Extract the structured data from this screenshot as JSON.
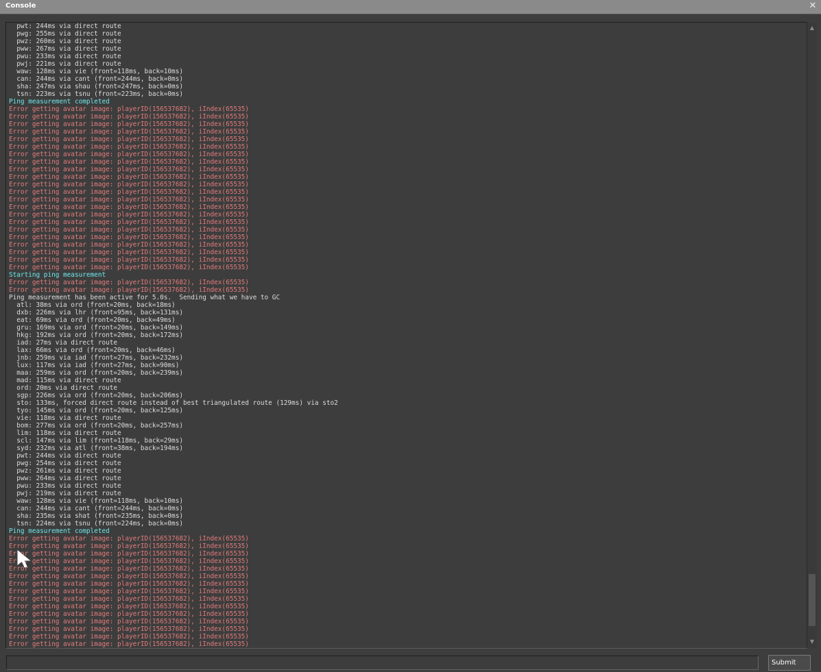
{
  "window": {
    "title": "Console",
    "close_glyph": "✕"
  },
  "console": {
    "lines": [
      {
        "text": "  pwt: 244ms via direct route",
        "type": "normal"
      },
      {
        "text": "  pwg: 255ms via direct route",
        "type": "normal"
      },
      {
        "text": "  pwz: 260ms via direct route",
        "type": "normal"
      },
      {
        "text": "  pww: 267ms via direct route",
        "type": "normal"
      },
      {
        "text": "  pwu: 233ms via direct route",
        "type": "normal"
      },
      {
        "text": "  pwj: 221ms via direct route",
        "type": "normal"
      },
      {
        "text": "  waw: 128ms via vie (front=118ms, back=10ms)",
        "type": "normal"
      },
      {
        "text": "  can: 244ms via cant (front=244ms, back=0ms)",
        "type": "normal"
      },
      {
        "text": "  sha: 247ms via shau (front=247ms, back=0ms)",
        "type": "normal"
      },
      {
        "text": "  tsn: 223ms via tsnu (front=223ms, back=0ms)",
        "type": "normal"
      },
      {
        "text": "Ping measurement completed",
        "type": "info"
      },
      {
        "text": "Error getting avatar image: playerID(156537682), iIndex(65535)",
        "type": "error"
      },
      {
        "text": "Error getting avatar image: playerID(156537682), iIndex(65535)",
        "type": "error"
      },
      {
        "text": "Error getting avatar image: playerID(156537682), iIndex(65535)",
        "type": "error"
      },
      {
        "text": "Error getting avatar image: playerID(156537682), iIndex(65535)",
        "type": "error"
      },
      {
        "text": "Error getting avatar image: playerID(156537682), iIndex(65535)",
        "type": "error"
      },
      {
        "text": "Error getting avatar image: playerID(156537682), iIndex(65535)",
        "type": "error"
      },
      {
        "text": "Error getting avatar image: playerID(156537682), iIndex(65535)",
        "type": "error"
      },
      {
        "text": "Error getting avatar image: playerID(156537682), iIndex(65535)",
        "type": "error"
      },
      {
        "text": "Error getting avatar image: playerID(156537682), iIndex(65535)",
        "type": "error"
      },
      {
        "text": "Error getting avatar image: playerID(156537682), iIndex(65535)",
        "type": "error"
      },
      {
        "text": "Error getting avatar image: playerID(156537682), iIndex(65535)",
        "type": "error"
      },
      {
        "text": "Error getting avatar image: playerID(156537682), iIndex(65535)",
        "type": "error"
      },
      {
        "text": "Error getting avatar image: playerID(156537682), iIndex(65535)",
        "type": "error"
      },
      {
        "text": "Error getting avatar image: playerID(156537682), iIndex(65535)",
        "type": "error"
      },
      {
        "text": "Error getting avatar image: playerID(156537682), iIndex(65535)",
        "type": "error"
      },
      {
        "text": "Error getting avatar image: playerID(156537682), iIndex(65535)",
        "type": "error"
      },
      {
        "text": "Error getting avatar image: playerID(156537682), iIndex(65535)",
        "type": "error"
      },
      {
        "text": "Error getting avatar image: playerID(156537682), iIndex(65535)",
        "type": "error"
      },
      {
        "text": "Error getting avatar image: playerID(156537682), iIndex(65535)",
        "type": "error"
      },
      {
        "text": "Error getting avatar image: playerID(156537682), iIndex(65535)",
        "type": "error"
      },
      {
        "text": "Error getting avatar image: playerID(156537682), iIndex(65535)",
        "type": "error"
      },
      {
        "text": "Error getting avatar image: playerID(156537682), iIndex(65535)",
        "type": "error"
      },
      {
        "text": "Starting ping measurement",
        "type": "info"
      },
      {
        "text": "Error getting avatar image: playerID(156537682), iIndex(65535)",
        "type": "error"
      },
      {
        "text": "Error getting avatar image: playerID(156537682), iIndex(65535)",
        "type": "error"
      },
      {
        "text": "Ping measurement has been active for 5.0s.  Sending what we have to GC",
        "type": "normal"
      },
      {
        "text": "  atl: 38ms via ord (front=20ms, back=18ms)",
        "type": "normal"
      },
      {
        "text": "  dxb: 226ms via lhr (front=95ms, back=131ms)",
        "type": "normal"
      },
      {
        "text": "  eat: 69ms via ord (front=20ms, back=49ms)",
        "type": "normal"
      },
      {
        "text": "  gru: 169ms via ord (front=20ms, back=149ms)",
        "type": "normal"
      },
      {
        "text": "  hkg: 192ms via ord (front=20ms, back=172ms)",
        "type": "normal"
      },
      {
        "text": "  iad: 27ms via direct route",
        "type": "normal"
      },
      {
        "text": "  lax: 66ms via ord (front=20ms, back=46ms)",
        "type": "normal"
      },
      {
        "text": "  jnb: 259ms via iad (front=27ms, back=232ms)",
        "type": "normal"
      },
      {
        "text": "  lux: 117ms via iad (front=27ms, back=90ms)",
        "type": "normal"
      },
      {
        "text": "  maa: 259ms via ord (front=20ms, back=239ms)",
        "type": "normal"
      },
      {
        "text": "  mad: 115ms via direct route",
        "type": "normal"
      },
      {
        "text": "  ord: 20ms via direct route",
        "type": "normal"
      },
      {
        "text": "  sgp: 226ms via ord (front=20ms, back=206ms)",
        "type": "normal"
      },
      {
        "text": "  sto: 133ms, forced direct route instead of best triangulated route (129ms) via sto2",
        "type": "normal"
      },
      {
        "text": "  tyo: 145ms via ord (front=20ms, back=125ms)",
        "type": "normal"
      },
      {
        "text": "  vie: 118ms via direct route",
        "type": "normal"
      },
      {
        "text": "  bom: 277ms via ord (front=20ms, back=257ms)",
        "type": "normal"
      },
      {
        "text": "  lim: 118ms via direct route",
        "type": "normal"
      },
      {
        "text": "  scl: 147ms via lim (front=118ms, back=29ms)",
        "type": "normal"
      },
      {
        "text": "  syd: 232ms via atl (front=38ms, back=194ms)",
        "type": "normal"
      },
      {
        "text": "  pwt: 244ms via direct route",
        "type": "normal"
      },
      {
        "text": "  pwg: 254ms via direct route",
        "type": "normal"
      },
      {
        "text": "  pwz: 261ms via direct route",
        "type": "normal"
      },
      {
        "text": "  pww: 264ms via direct route",
        "type": "normal"
      },
      {
        "text": "  pwu: 233ms via direct route",
        "type": "normal"
      },
      {
        "text": "  pwj: 219ms via direct route",
        "type": "normal"
      },
      {
        "text": "  waw: 128ms via vie (front=118ms, back=10ms)",
        "type": "normal"
      },
      {
        "text": "  can: 244ms via cant (front=244ms, back=0ms)",
        "type": "normal"
      },
      {
        "text": "  sha: 235ms via shat (front=235ms, back=0ms)",
        "type": "normal"
      },
      {
        "text": "  tsn: 224ms via tsnu (front=224ms, back=0ms)",
        "type": "normal"
      },
      {
        "text": "Ping measurement completed",
        "type": "info"
      },
      {
        "text": "Error getting avatar image: playerID(156537682), iIndex(65535)",
        "type": "error"
      },
      {
        "text": "Error getting avatar image: playerID(156537682), iIndex(65535)",
        "type": "error"
      },
      {
        "text": "Error getting avatar image: playerID(156537682), iIndex(65535)",
        "type": "error"
      },
      {
        "text": "Error getting avatar image: playerID(156537682), iIndex(65535)",
        "type": "error"
      },
      {
        "text": "Error getting avatar image: playerID(156537682), iIndex(65535)",
        "type": "error"
      },
      {
        "text": "Error getting avatar image: playerID(156537682), iIndex(65535)",
        "type": "error"
      },
      {
        "text": "Error getting avatar image: playerID(156537682), iIndex(65535)",
        "type": "error"
      },
      {
        "text": "Error getting avatar image: playerID(156537682), iIndex(65535)",
        "type": "error"
      },
      {
        "text": "Error getting avatar image: playerID(156537682), iIndex(65535)",
        "type": "error"
      },
      {
        "text": "Error getting avatar image: playerID(156537682), iIndex(65535)",
        "type": "error"
      },
      {
        "text": "Error getting avatar image: playerID(156537682), iIndex(65535)",
        "type": "error"
      },
      {
        "text": "Error getting avatar image: playerID(156537682), iIndex(65535)",
        "type": "error"
      },
      {
        "text": "Error getting avatar image: playerID(156537682), iIndex(65535)",
        "type": "error"
      },
      {
        "text": "Error getting avatar image: playerID(156537682), iIndex(65535)",
        "type": "error"
      },
      {
        "text": "Error getting avatar image: playerID(156537682), iIndex(65535)",
        "type": "error"
      }
    ],
    "input": {
      "value": "",
      "placeholder": ""
    },
    "submit_label": "Submit"
  },
  "scrollbar": {
    "position": 0.98,
    "up_icon": "▲",
    "down_icon": "▼"
  },
  "colors": {
    "background": "#3d3d3d",
    "titlebar": "#8a8a8a",
    "text_normal": "#dcdcdc",
    "text_error": "#e37c7c",
    "text_info": "#6fe6ea"
  },
  "icons": {
    "close": "close-icon",
    "cursor": "mouse-pointer-icon"
  }
}
